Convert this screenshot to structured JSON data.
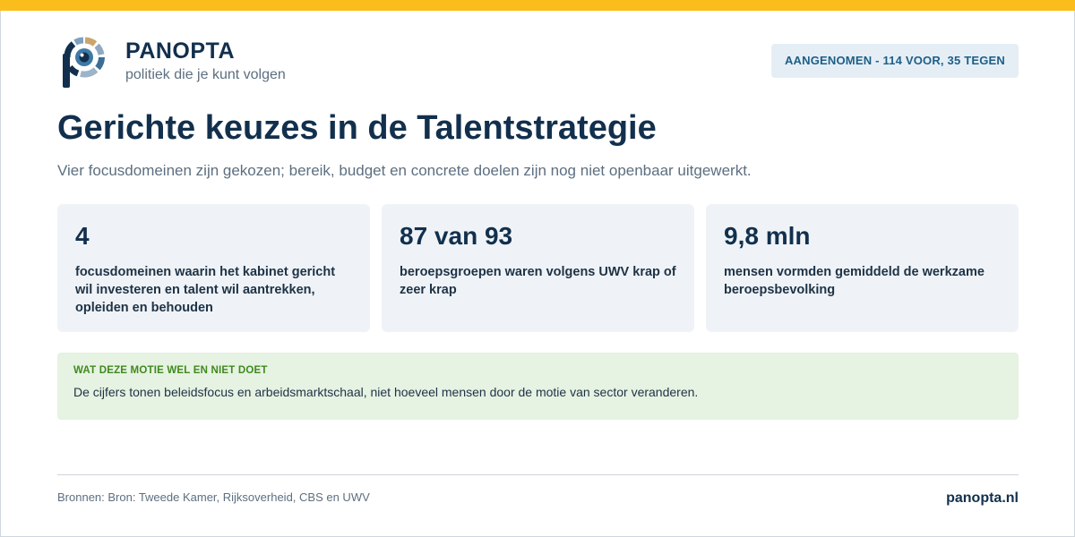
{
  "brand": {
    "name": "PANOPTA",
    "tagline": "politiek die je kunt volgen",
    "accent_color": "#fbbd1b",
    "logo_icon": "eye-p-logo-icon"
  },
  "status": {
    "label": "AANGENOMEN - 114 VOOR, 35 TEGEN"
  },
  "header": {
    "title": "Gerichte keuzes in de Talentstrategie",
    "subtitle": "Vier focusdomeinen zijn gekozen; bereik, budget en concrete doelen zijn nog niet openbaar uitgewerkt."
  },
  "stats": [
    {
      "value": "4",
      "description": "focusdomeinen waarin het kabinet gericht wil investeren en talent wil aantrekken, opleiden en behouden"
    },
    {
      "value": "87 van 93",
      "description": "beroepsgroepen waren volgens UWV krap of zeer krap"
    },
    {
      "value": "9,8 mln",
      "description": "mensen vormden gemiddeld de werkzame beroepsbevolking"
    }
  ],
  "callout": {
    "heading": "WAT DEZE MOTIE WEL EN NIET DOET",
    "text": "De cijfers tonen beleidsfocus en arbeidsmarktschaal, niet hoeveel mensen door de motie van sector veranderen."
  },
  "footer": {
    "sources": "Bronnen: Bron: Tweede Kamer, Rijksoverheid, CBS en UWV",
    "url": "panopta.nl"
  }
}
